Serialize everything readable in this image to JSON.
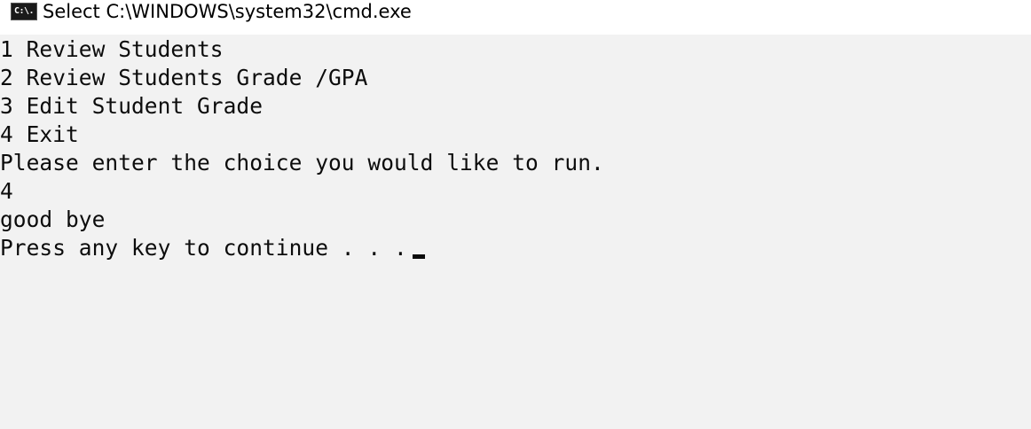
{
  "window": {
    "title": "Select C:\\WINDOWS\\system32\\cmd.exe",
    "icon": "cmd-icon",
    "icon_glyph": "C:\\."
  },
  "console": {
    "lines": [
      "1 Review Students",
      "2 Review Students Grade /GPA",
      "3 Edit Student Grade",
      "4 Exit",
      "Please enter the choice you would like to run.",
      "4",
      "good bye",
      "Press any key to continue . . ."
    ],
    "cursor": "underscore-block"
  },
  "colors": {
    "title_bg": "#ffffff",
    "console_bg": "#f2f2f2",
    "text": "#0c0c0c"
  }
}
